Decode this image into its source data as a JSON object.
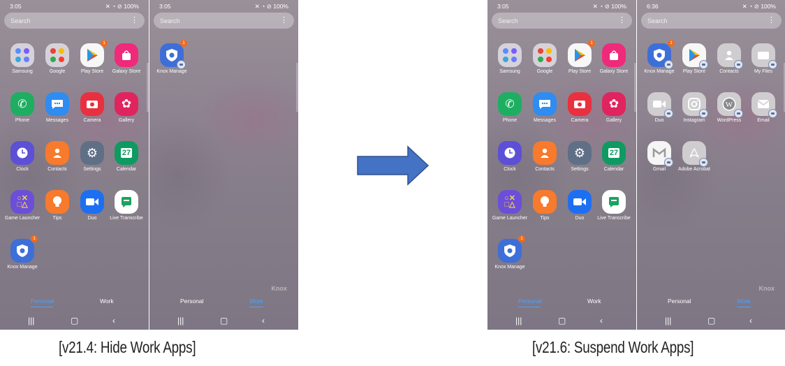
{
  "colors": {
    "badge": "#f36a1b",
    "active_tab": "#4aa2ff",
    "arrow": "#4472c4"
  },
  "screens": {
    "s1": {
      "time": "3:05",
      "right_status": "100%",
      "search_placeholder": "Search",
      "personal_tab": "Personal",
      "work_tab": "Work",
      "apps": [
        "Samsung",
        "Google",
        "Play Store",
        "Galaxy Store",
        "Phone",
        "Messages",
        "Camera",
        "Gallery",
        "Clock",
        "Contacts",
        "Settings",
        "Calendar",
        "Game Launcher",
        "Tips",
        "Duo",
        "Live Transcribe",
        "Knox Manage"
      ],
      "badges": [
        "1",
        "1"
      ],
      "calendar_day": "27"
    },
    "s2": {
      "time": "3:05",
      "right_status": "100%",
      "search_placeholder": "Search",
      "personal_tab": "Personal",
      "work_tab": "Work",
      "apps": [
        "Knox Manage"
      ],
      "badges": [
        "1"
      ],
      "watermark": "Knox"
    },
    "s3": {
      "time": "3:05",
      "right_status": "100%",
      "search_placeholder": "Search",
      "personal_tab": "Personal",
      "work_tab": "Work",
      "apps": [
        "Samsung",
        "Google",
        "Play Store",
        "Galaxy Store",
        "Phone",
        "Messages",
        "Camera",
        "Gallery",
        "Clock",
        "Contacts",
        "Settings",
        "Calendar",
        "Game Launcher",
        "Tips",
        "Duo",
        "Live Transcribe",
        "Knox Manage"
      ],
      "badges": [
        "1",
        "1"
      ],
      "calendar_day": "27"
    },
    "s4": {
      "time": "6:36",
      "right_status": "100%",
      "search_placeholder": "Search",
      "personal_tab": "Personal",
      "work_tab": "Work",
      "apps": [
        "Knox Manage",
        "Play Store",
        "Contacts",
        "My Files",
        "Duo",
        "Instagram",
        "WordPress",
        "Email",
        "Gmail",
        "Adobe Acrobat"
      ],
      "badges": [
        "1"
      ],
      "watermark": "Knox"
    }
  },
  "captions": {
    "left": "[v21.4: Hide Work Apps]",
    "right": "[v21.6: Suspend Work Apps]"
  }
}
